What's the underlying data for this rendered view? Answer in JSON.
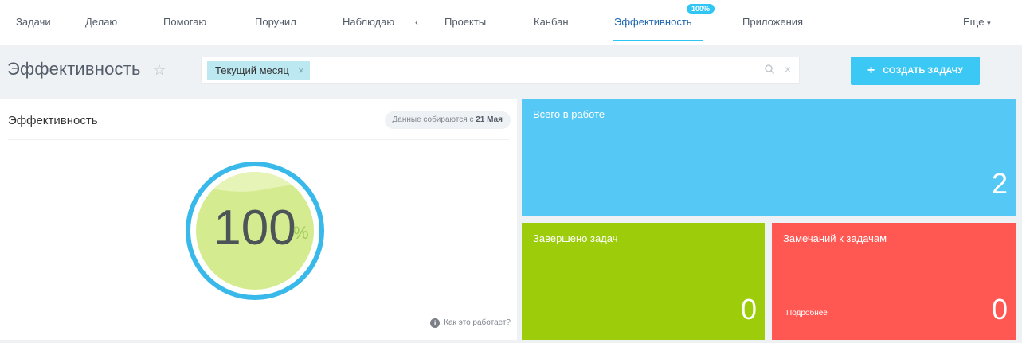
{
  "tabs": {
    "left": [
      "Задачи",
      "Делаю",
      "Помогаю",
      "Поручил",
      "Наблюдаю"
    ],
    "collapse_glyph": "‹",
    "right": [
      "Проекты",
      "Канбан",
      "Эффективность",
      "Приложения"
    ],
    "active": "Эффективность",
    "efficiency_badge": "100%",
    "more_label": "Еще",
    "more_chevron": "▾"
  },
  "header": {
    "title": "Эффективность",
    "star_icon": "star-icon",
    "filter_chip": "Текущий месяц",
    "chip_close": "×",
    "clear_glyph": "×",
    "create_button": "СОЗДАТЬ ЗАДАЧУ",
    "create_icon": "+"
  },
  "efficiency_card": {
    "title": "Эффективность",
    "collect_prefix": "Данные собираются с",
    "collect_date": "21 Мая",
    "gauge_value": "100",
    "gauge_unit": "%",
    "gauge_level": 1.0,
    "help_text": "Как это работает?",
    "info_glyph": "i"
  },
  "tiles": {
    "total": {
      "label": "Всего в работе",
      "value": "2"
    },
    "done": {
      "label": "Завершено задач",
      "value": "0"
    },
    "remarks": {
      "label": "Замечаний к задачам",
      "value": "0",
      "more": "Подробнее"
    }
  },
  "colors": {
    "accent": "#2fc6f6",
    "tile_total": "#55c8f5",
    "tile_done": "#9ccc0a",
    "tile_remarks": "#ff5752",
    "gauge_fill": "#d4ec8f"
  }
}
